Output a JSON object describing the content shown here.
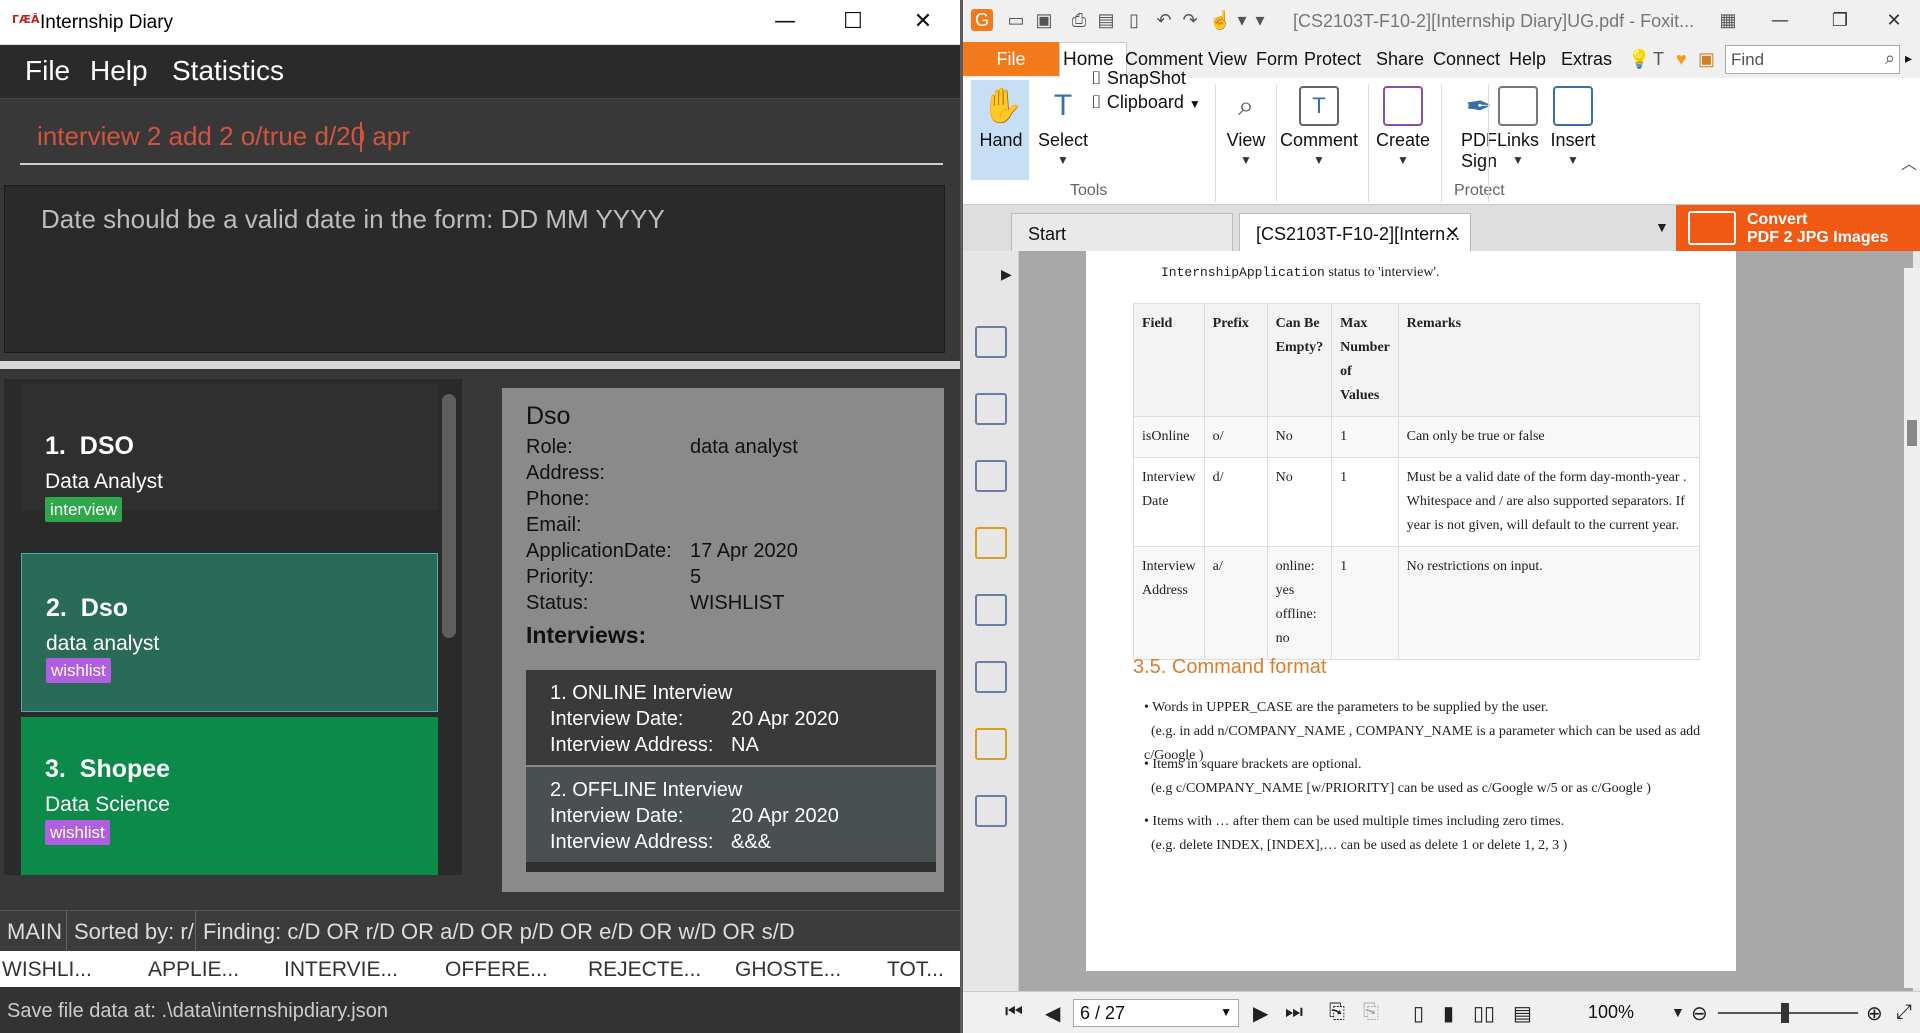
{
  "left_window": {
    "title": "Internship Diary",
    "icon_text": "ΓÆÂ",
    "win_minimize": "—",
    "win_maximize": "☐",
    "win_close": "✕",
    "menu": [
      "File",
      "Help",
      "Statistics"
    ],
    "command": "interview 2 add 2 o/true d/20 apr",
    "result": "Date should be a valid date in the form: DD MM YYYY",
    "cards": [
      {
        "index": "1.",
        "company": "DSO",
        "role": "Data Analyst",
        "tag": "interview"
      },
      {
        "index": "2.",
        "company": "Dso",
        "role": "data analyst",
        "tag": "wishlist"
      },
      {
        "index": "3.",
        "company": "Shopee",
        "role": "Data Science",
        "tag": "wishlist"
      }
    ],
    "detail": {
      "title": "Dso",
      "fields": [
        {
          "label": "Role:",
          "value": "data analyst"
        },
        {
          "label": "Address:",
          "value": ""
        },
        {
          "label": "Phone:",
          "value": ""
        },
        {
          "label": "Email:",
          "value": ""
        },
        {
          "label": "ApplicationDate:",
          "value": "17 Apr 2020"
        },
        {
          "label": "Priority:",
          "value": "5"
        },
        {
          "label": "Status:",
          "value": "WISHLIST"
        }
      ],
      "interviews_heading": "Interviews:",
      "interviews": [
        {
          "title": "1. ONLINE Interview",
          "date_label": "Interview Date:",
          "date": "20 Apr 2020",
          "addr_label": "Interview Address:",
          "addr": "NA"
        },
        {
          "title": "2. OFFLINE Interview",
          "date_label": "Interview Date:",
          "date": "20 Apr 2020",
          "addr_label": "Interview Address:",
          "addr": "&&&"
        }
      ]
    },
    "status": {
      "view": "MAIN",
      "sorted": "Sorted by: r/",
      "finding": "Finding: c/D OR r/D OR a/D OR p/D OR e/D OR w/D OR s/D",
      "counts": [
        "WISHLI...",
        "APPLIE...",
        "INTERVIE...",
        "OFFERE...",
        "REJECTE...",
        "GHOSTE...",
        "TOT..."
      ],
      "save": "Save file data at: .\\data\\internshipdiary.json"
    },
    "colors": {
      "interview_tag": "#2ea84a",
      "wishlist_tag": "#b15ee0",
      "card_selected": "#2a6b58",
      "card_green": "#0b8a4a",
      "error_text": "#d0543f"
    }
  },
  "right_window": {
    "title": "[CS2103T-F10-2][Internship Diary]UG.pdf - Foxit...",
    "file_tab": "File",
    "tabs": [
      "Home",
      "Comment",
      "View",
      "Form",
      "Protect",
      "Share",
      "Connect",
      "Help",
      "Extras"
    ],
    "find_placeholder": "Find",
    "ribbon": {
      "hand": "Hand",
      "select": "Select",
      "snapshot": "SnapShot",
      "clipboard": "Clipboard",
      "tools_group": "Tools",
      "view": "View",
      "comment": "Comment",
      "create": "Create",
      "pdf_sign_1": "PDF",
      "pdf_sign_2": "Sign",
      "protect_group": "Protect",
      "links": "Links",
      "insert": "Insert"
    },
    "doc_tabs": [
      "Start",
      "[CS2103T-F10-2][Intern..."
    ],
    "convert_l1": "Convert",
    "convert_l2": "PDF 2 JPG Images",
    "pdf": {
      "top_text_prefix": "InternshipApplication",
      "top_text_suffix": "status to 'interview'.",
      "headers": [
        "Field",
        "Prefix",
        "Can Be Empty?",
        "Max Number of Values",
        "Remarks"
      ],
      "rows": [
        [
          "isOnline",
          "o/",
          "No",
          "1",
          "Can only be true or false"
        ],
        [
          "Interview Date",
          "d/",
          "No",
          "1",
          "Must be a valid date of the form day-month-year . Whitespace and / are also supported separators. If year is not given, will default to the current year."
        ],
        [
          "Interview Address",
          "a/",
          "online: yes offline: no",
          "1",
          "No restrictions on input."
        ]
      ],
      "section": "3.5. Command format",
      "bullets": [
        {
          "l1": "Words in UPPER_CASE are the parameters to be supplied by the user.",
          "l2": "(e.g. in add n/COMPANY_NAME , COMPANY_NAME is a parameter which can be used as add c/Google )"
        },
        {
          "l1": "Items in square brackets are optional.",
          "l2": "(e.g c/COMPANY_NAME [w/PRIORITY] can be used as c/Google w/5 or as c/Google )"
        },
        {
          "l1": "Items with … after them can be used multiple times including zero times.",
          "l2": "(e.g. delete INDEX, [INDEX],… can be used as delete 1 or delete 1, 2, 3 )"
        }
      ]
    },
    "page_nav": "6 / 27",
    "zoom": "100%"
  }
}
